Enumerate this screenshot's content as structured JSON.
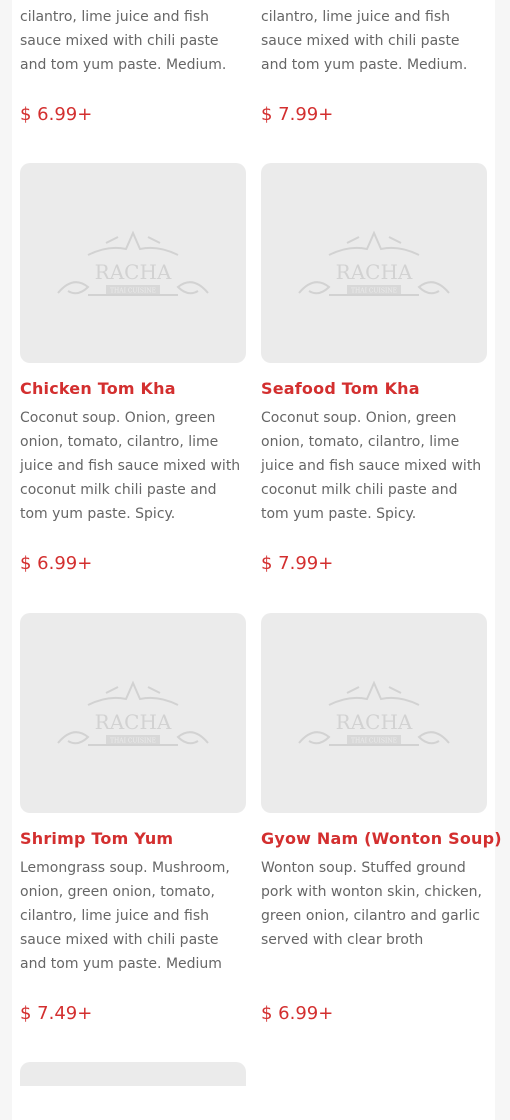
{
  "top": {
    "left_desc_lines": [
      "cilantro, lime juice and fish",
      "sauce mixed with chili paste",
      "and tom yum paste. Medium."
    ],
    "right_desc_lines": [
      "cilantro, lime juice and fish",
      "sauce mixed with chili paste",
      "and tom yum paste. Medium."
    ],
    "left_price": "$ 6.99+",
    "right_price": "$ 7.99+"
  },
  "logo": {
    "brand": "RACHA",
    "tagline": "THAI CUISINE"
  },
  "items": [
    {
      "name": "Chicken Tom Kha",
      "description": "Coconut soup. Onion, green onion, tomato, cilantro, lime juice and fish sauce mixed with coconut milk chili paste and tom yum paste. Spicy.",
      "price": "$ 6.99+"
    },
    {
      "name": "Seafood Tom Kha",
      "description": "Coconut soup. Onion, green onion, tomato, cilantro, lime juice and fish sauce mixed with coconut milk chili paste and tom yum paste. Spicy.",
      "price": "$ 7.99+"
    },
    {
      "name": "Shrimp Tom Yum",
      "description": "Lemongrass soup. Mushroom, onion, green onion, tomato, cilantro, lime juice and fish sauce mixed with chili paste and tom yum paste. Medium",
      "price": "$ 7.49+"
    },
    {
      "name": "Gyow Nam (Wonton Soup)",
      "description": "Wonton soup. Stuffed ground pork with wonton skin, chicken, green onion, cilantro and garlic served with clear broth",
      "price": "$ 6.99+"
    }
  ],
  "colors": {
    "accent": "#d32f2f",
    "thumb_bg": "#ebebeb",
    "text": "#666666"
  }
}
